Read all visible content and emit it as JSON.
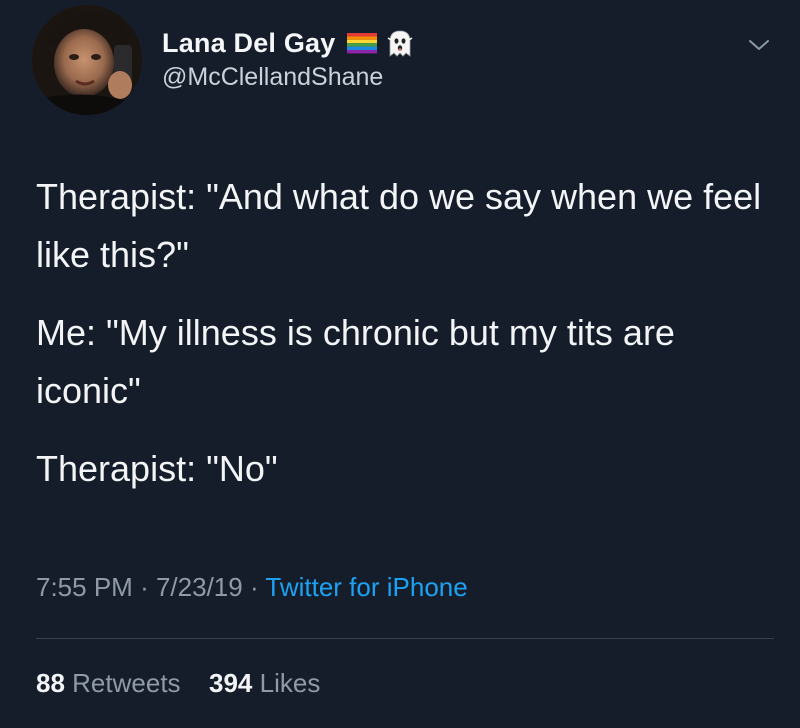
{
  "user": {
    "display_name": "Lana Del Gay",
    "handle": "@McClellandShane",
    "emoji_icons": [
      "rainbow-flag-icon",
      "ghost-icon"
    ]
  },
  "tweet": {
    "lines": [
      "Therapist: \"And what do we say when we feel like this?\"",
      "Me: \"My illness is chronic but my tits are iconic\"",
      "Therapist: \"No\""
    ],
    "time": "7:55 PM",
    "separator": "·",
    "date": "7/23/19",
    "source": "Twitter for iPhone"
  },
  "stats": {
    "retweets_count": "88",
    "retweets_label": "Retweets",
    "likes_count": "394",
    "likes_label": "Likes"
  },
  "colors": {
    "background": "#151d2a",
    "text": "#f2f4f6",
    "muted": "#8f9aa6",
    "link": "#1da1f2"
  }
}
